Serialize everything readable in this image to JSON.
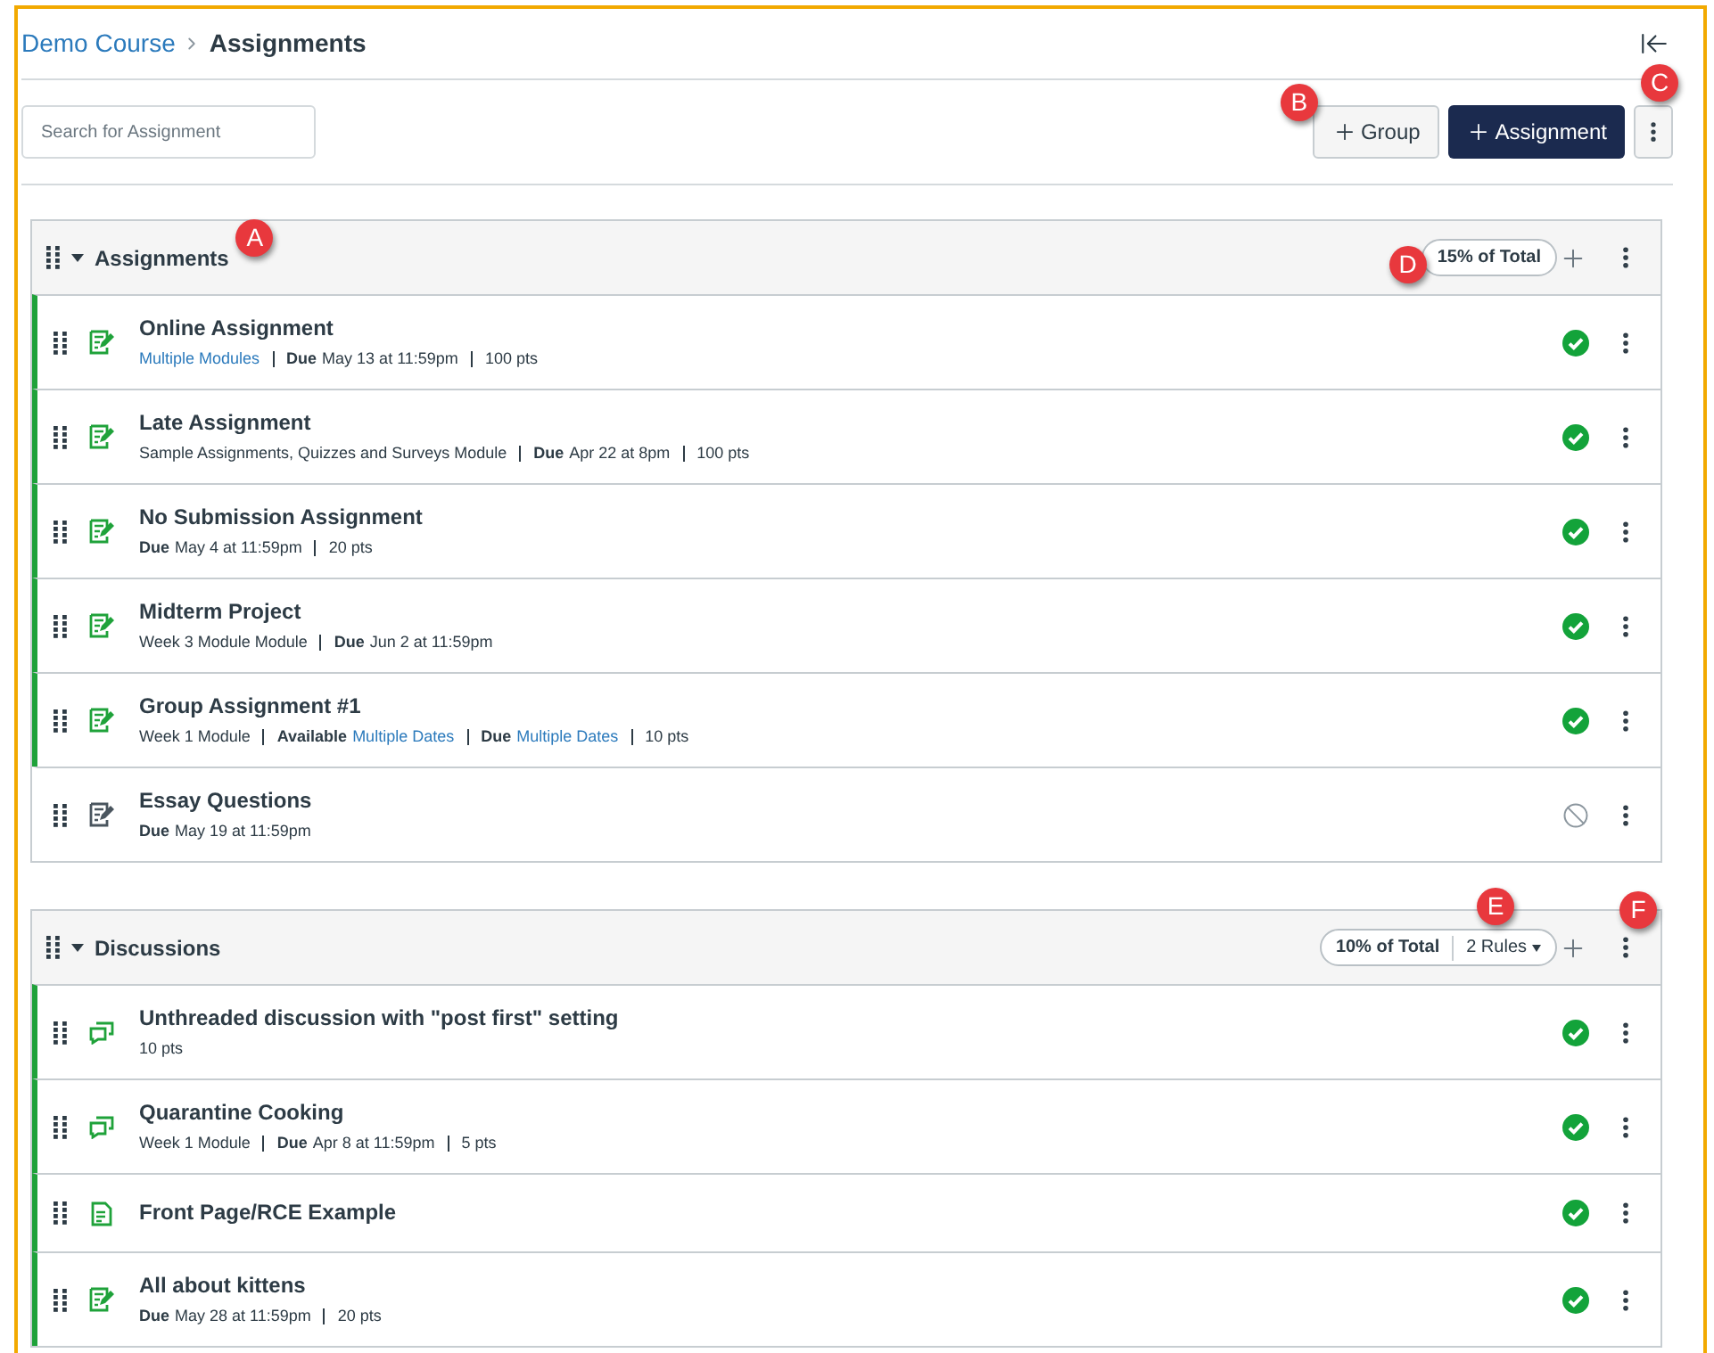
{
  "breadcrumb": [
    {
      "text": "Demo Course",
      "link": true
    },
    {
      "text": "Assignments",
      "link": false
    }
  ],
  "search": {
    "placeholder": "Search for Assignment"
  },
  "toolbar": {
    "group_button": {
      "label": "Group",
      "callout": "B"
    },
    "add_button": {
      "label": "Assignment"
    },
    "menu_callout": "C"
  },
  "groups": [
    {
      "title": "Assignments",
      "expanded": true,
      "title_callout": "A",
      "weight": "15% of Total",
      "weight_callout": "D",
      "items": [
        {
          "title": "Online Assignment",
          "kind": "assignment",
          "published": true,
          "meta": [
            {
              "text": "Multiple Modules",
              "link": true
            },
            {
              "label": "Due",
              "text": "May 13 at 11:59pm"
            },
            {
              "text": "100 pts"
            }
          ]
        },
        {
          "title": "Late Assignment",
          "kind": "assignment",
          "published": true,
          "meta": [
            {
              "text": "Sample Assignments, Quizzes and Surveys Module"
            },
            {
              "label": "Due",
              "text": "Apr 22 at 8pm"
            },
            {
              "text": "100 pts"
            }
          ]
        },
        {
          "title": "No Submission Assignment",
          "kind": "assignment",
          "published": true,
          "meta": [
            {
              "label": "Due",
              "text": "May 4 at 11:59pm"
            },
            {
              "text": "20 pts"
            }
          ]
        },
        {
          "title": "Midterm Project",
          "kind": "assignment",
          "published": true,
          "meta": [
            {
              "text": "Week 3 Module Module"
            },
            {
              "label": "Due",
              "text": "Jun 2 at 11:59pm"
            }
          ]
        },
        {
          "title": "Group Assignment #1",
          "kind": "assignment",
          "published": true,
          "meta": [
            {
              "text": "Week 1 Module"
            },
            {
              "label": "Available",
              "text": "Multiple Dates",
              "link": true
            },
            {
              "label": "Due",
              "text": "Multiple Dates",
              "link": true
            },
            {
              "text": "10 pts"
            }
          ]
        },
        {
          "title": "Essay Questions",
          "kind": "assignment",
          "published": false,
          "meta": [
            {
              "label": "Due",
              "text": "May 19 at 11:59pm"
            }
          ]
        }
      ]
    },
    {
      "title": "Discussions",
      "expanded": true,
      "weight": "10% of Total",
      "rules": "2 Rules",
      "rules_callout": "E",
      "menu_callout": "F",
      "items": [
        {
          "title": "Unthreaded discussion with \"post first\" setting",
          "kind": "discussion",
          "published": true,
          "meta": [
            {
              "text": "10 pts"
            }
          ]
        },
        {
          "title": "Quarantine Cooking",
          "kind": "discussion",
          "published": true,
          "meta": [
            {
              "text": "Week 1 Module"
            },
            {
              "label": "Due",
              "text": "Apr 8 at 11:59pm"
            },
            {
              "text": "5 pts"
            }
          ]
        },
        {
          "title": "Front Page/RCE Example",
          "kind": "page",
          "published": true
        },
        {
          "title": "All about kittens",
          "kind": "assignment",
          "published": true,
          "meta": [
            {
              "label": "Due",
              "text": "May 28 at 11:59pm"
            },
            {
              "text": "20 pts"
            }
          ]
        }
      ]
    }
  ]
}
